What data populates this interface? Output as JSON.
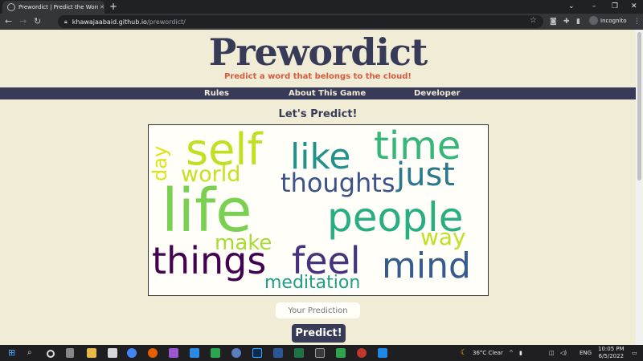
{
  "browser": {
    "tab_title": "Prewordict | Predict the Word in C",
    "tab_close": "✕",
    "new_tab": "+",
    "url_host": "khawajaabaid.github.io",
    "url_path": "/prewordict/",
    "profile_label": "Incognito"
  },
  "page": {
    "logo": "Prewordict",
    "tagline": "Predict a word that belongs to the cloud!",
    "nav": [
      "Rules",
      "About This Game",
      "Developer"
    ],
    "heading": "Let's Predict!",
    "input_placeholder": "Your Prediction",
    "predict_button": "Predict!"
  },
  "cloud_words": [
    {
      "text": "self",
      "color": "#c2df23"
    },
    {
      "text": "time",
      "color": "#35b779"
    },
    {
      "text": "like",
      "color": "#21918c"
    },
    {
      "text": "just",
      "color": "#2a788e"
    },
    {
      "text": "day",
      "color": "#dde318"
    },
    {
      "text": "world",
      "color": "#c8e020"
    },
    {
      "text": "thoughts",
      "color": "#3b528b"
    },
    {
      "text": "life",
      "color": "#7ad151"
    },
    {
      "text": "people",
      "color": "#28ae80"
    },
    {
      "text": "way",
      "color": "#c0df25"
    },
    {
      "text": "make",
      "color": "#a8db34"
    },
    {
      "text": "things",
      "color": "#440154"
    },
    {
      "text": "feel",
      "color": "#46327e"
    },
    {
      "text": "mind",
      "color": "#365c8d"
    },
    {
      "text": "meditation",
      "color": "#1f9e89"
    }
  ],
  "taskbar": {
    "weather": "36°C  Clear",
    "language": "ENG",
    "time": "10:05 PM",
    "date": "6/5/2022"
  }
}
